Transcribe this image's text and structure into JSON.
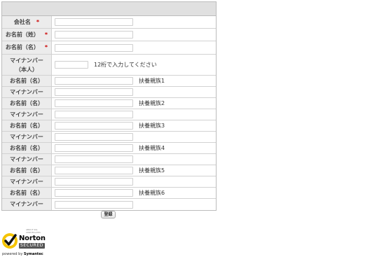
{
  "form": {
    "rows": [
      {
        "label": "会社名",
        "required": "*",
        "note": ""
      },
      {
        "label": "お名前（姓）",
        "required": "*",
        "note": ""
      },
      {
        "label": "お名前（名）",
        "required": "*",
        "note": ""
      },
      {
        "label": "マイナンバー（本人）",
        "required": "*",
        "note": "12桁で入力してください"
      },
      {
        "label": "お名前（名）",
        "required": "",
        "note": "扶養親族1"
      },
      {
        "label": "マイナンバー",
        "required": "",
        "note": ""
      },
      {
        "label": "お名前（名）",
        "required": "",
        "note": "扶養親族2"
      },
      {
        "label": "マイナンバー",
        "required": "",
        "note": ""
      },
      {
        "label": "お名前（名）",
        "required": "",
        "note": "扶養親族3"
      },
      {
        "label": "マイナンバー",
        "required": "",
        "note": ""
      },
      {
        "label": "お名前（名）",
        "required": "",
        "note": "扶養親族4"
      },
      {
        "label": "マイナンバー",
        "required": "",
        "note": ""
      },
      {
        "label": "お名前（名）",
        "required": "",
        "note": "扶養親族5"
      },
      {
        "label": "マイナンバー",
        "required": "",
        "note": ""
      },
      {
        "label": "お名前（名）",
        "required": "",
        "note": "扶養親族6"
      },
      {
        "label": "マイナンバー",
        "required": "",
        "note": ""
      }
    ],
    "submit_label": "登録"
  },
  "norton": {
    "small_text": "ABOUT SSL CERTIFICATES",
    "brand": "Norton",
    "secured": "SECURED",
    "powered_prefix": "powered by",
    "powered_brand": "Symantec"
  },
  "colors": {
    "required": "#cc0000",
    "header_bg": "#e0e0e0",
    "label_bg": "#ececec",
    "norton_yellow": "#f5c400"
  }
}
